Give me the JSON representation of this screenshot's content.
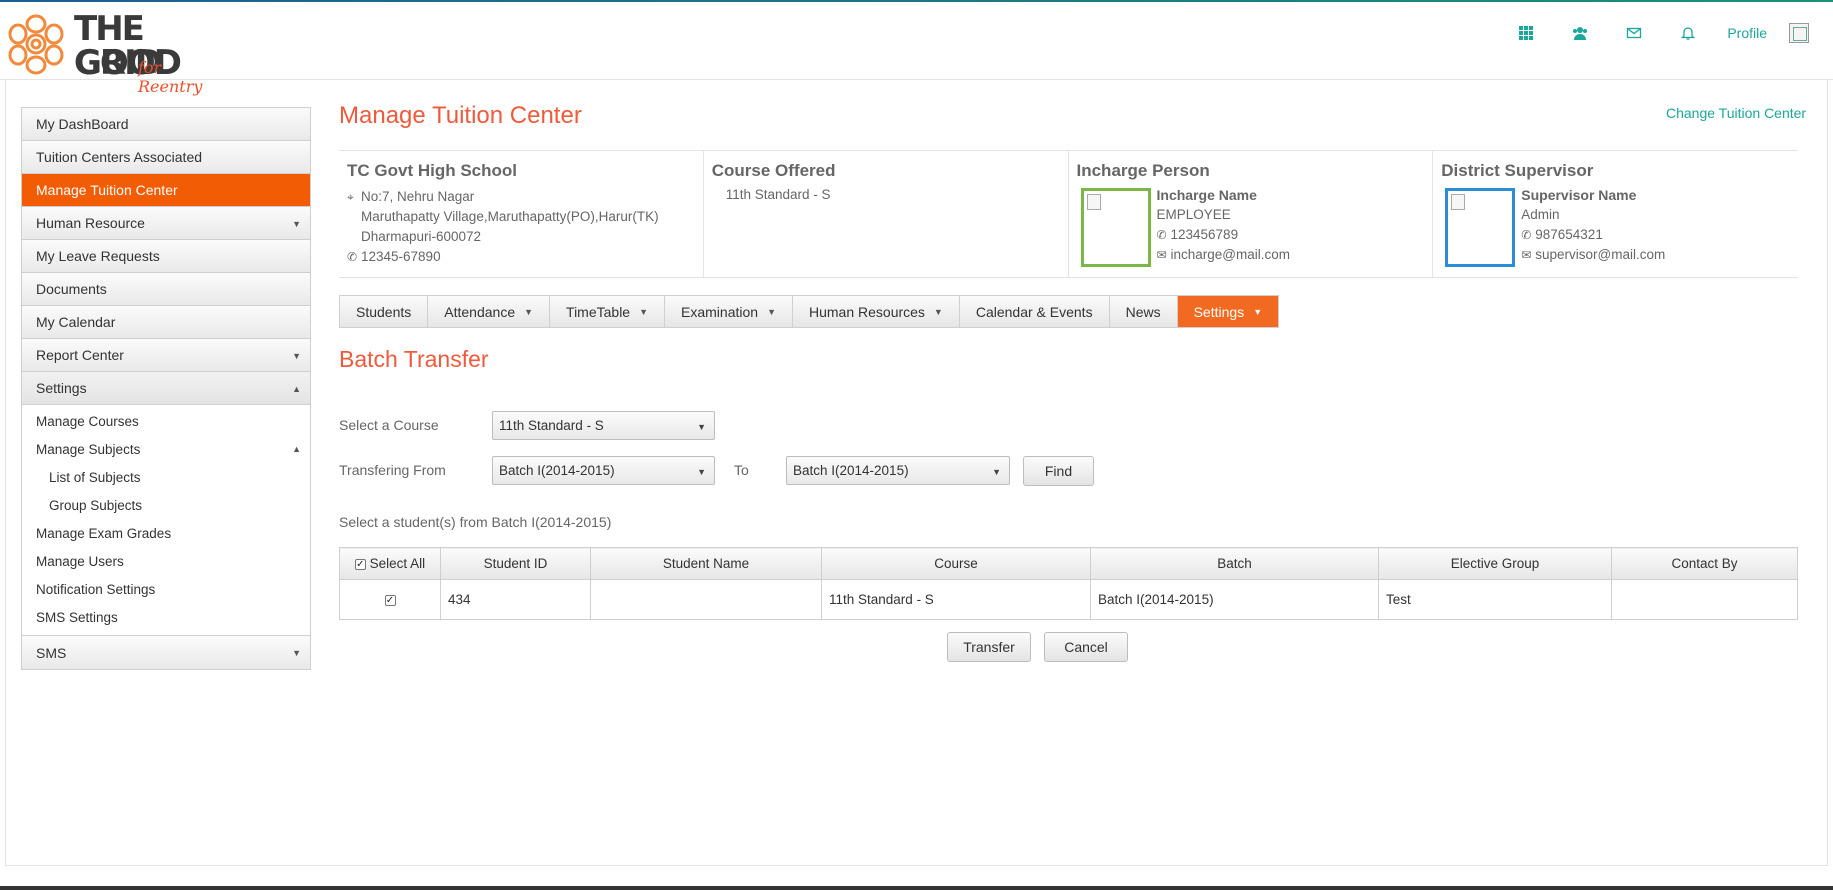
{
  "header": {
    "logo": {
      "line1": "THE GOOD",
      "line2": "GRID",
      "script": "for Reentry"
    },
    "icons": [
      "grid-icon",
      "users-icon",
      "mail-icon",
      "bell-icon"
    ],
    "profile_label": "Profile"
  },
  "sidebar": {
    "items": [
      {
        "label": "My DashBoard"
      },
      {
        "label": "Tuition Centers Associated"
      },
      {
        "label": "Manage Tuition Center"
      },
      {
        "label": "Human Resource"
      },
      {
        "label": "My Leave Requests"
      },
      {
        "label": "Documents"
      },
      {
        "label": "My Calendar"
      },
      {
        "label": "Report Center"
      },
      {
        "label": "Settings"
      },
      {
        "label": "SMS"
      }
    ],
    "settings_sub": [
      {
        "label": "Manage Courses"
      },
      {
        "label": "Manage Subjects"
      },
      {
        "label": "List of Subjects"
      },
      {
        "label": "Group Subjects"
      },
      {
        "label": "Manage Exam Grades"
      },
      {
        "label": "Manage Users"
      },
      {
        "label": "Notification Settings"
      },
      {
        "label": "SMS Settings"
      }
    ]
  },
  "main": {
    "title": "Manage Tuition Center",
    "change_link": "Change Tuition Center",
    "center": {
      "name": "TC Govt High School",
      "address1": "No:7, Nehru Nagar",
      "address2": "Maruthapatty Village,Maruthapatty(PO),Harur(TK)",
      "address3": "Dharmapuri-600072",
      "phone": "12345-67890"
    },
    "course": {
      "title": "Course Offered",
      "value": "11th Standard - S"
    },
    "incharge": {
      "title": "Incharge Person",
      "name": "Incharge Name",
      "role": "EMPLOYEE",
      "phone": "123456789",
      "email": "incharge@mail.com"
    },
    "supervisor": {
      "title": "District Supervisor",
      "name": "Supervisor Name",
      "role": "Admin",
      "phone": "987654321",
      "email": "supervisor@mail.com"
    },
    "tabs": [
      {
        "label": "Students"
      },
      {
        "label": "Attendance"
      },
      {
        "label": "TimeTable"
      },
      {
        "label": "Examination"
      },
      {
        "label": "Human Resources"
      },
      {
        "label": "Calendar & Events"
      },
      {
        "label": "News"
      },
      {
        "label": "Settings"
      }
    ],
    "section_title": "Batch Transfer",
    "form": {
      "course_label": "Select a Course",
      "course_value": "11th Standard - S",
      "from_label": "Transfering From",
      "from_value": "Batch I(2014-2015)",
      "to_label": "To",
      "to_value": "Batch I(2014-2015)",
      "find_label": "Find"
    },
    "hint": "Select a student(s) from Batch I(2014-2015)",
    "table": {
      "headers": [
        "Select All",
        "Student ID",
        "Student Name",
        "Course",
        "Batch",
        "Elective Group",
        "Contact By"
      ],
      "rows": [
        {
          "checked": true,
          "id": "434",
          "name": "",
          "course": "11th Standard - S",
          "batch": "Batch I(2014-2015)",
          "elective": "Test",
          "contact": ""
        }
      ]
    },
    "transfer_label": "Transfer",
    "cancel_label": "Cancel"
  },
  "colors": {
    "accent": "#f25c05",
    "title": "#f05a3c",
    "link": "#1aa89a",
    "incharge_border": "#7ab648",
    "supervisor_border": "#2d8cd6"
  }
}
